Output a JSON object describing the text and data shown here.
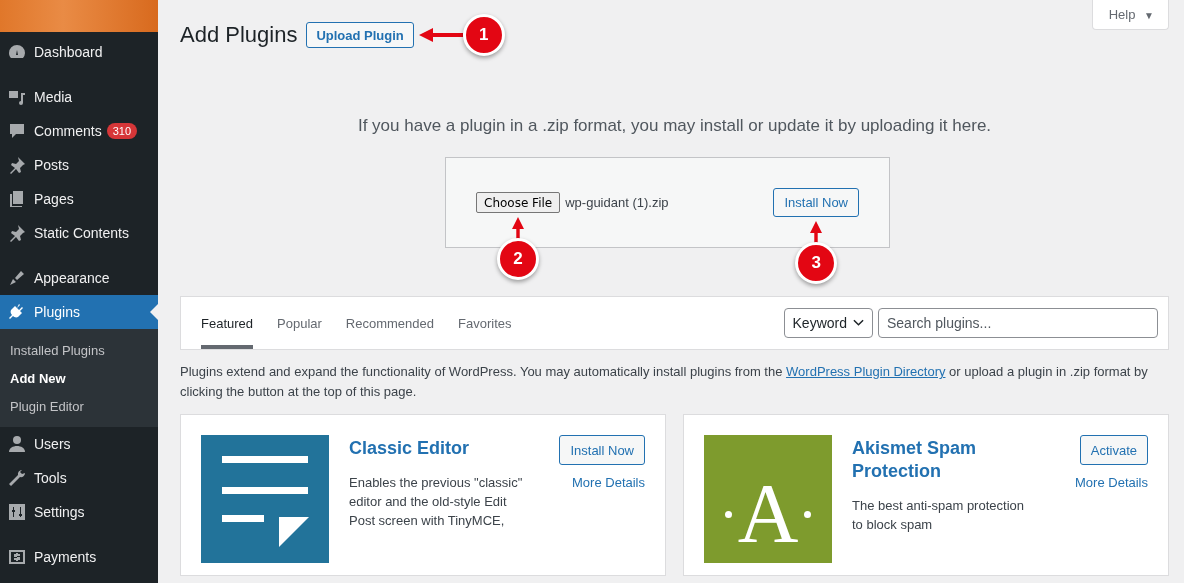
{
  "sidebar": {
    "groups": [
      {
        "items": [
          {
            "label": "Dashboard",
            "selected": false
          }
        ]
      },
      {
        "items": [
          {
            "label": "Media",
            "selected": false
          },
          {
            "label": "Comments",
            "selected": false,
            "badge": "310"
          },
          {
            "label": "Posts",
            "selected": false
          },
          {
            "label": "Pages",
            "selected": false
          },
          {
            "label": "Static Contents",
            "selected": false
          }
        ]
      },
      {
        "items": [
          {
            "label": "Appearance",
            "selected": false
          },
          {
            "label": "Plugins",
            "selected": true,
            "children": [
              {
                "label": "Installed Plugins",
                "selected": false
              },
              {
                "label": "Add New",
                "selected": true
              },
              {
                "label": "Plugin Editor",
                "selected": false
              }
            ]
          },
          {
            "label": "Users",
            "selected": false
          },
          {
            "label": "Tools",
            "selected": false
          },
          {
            "label": "Settings",
            "selected": false
          }
        ]
      },
      {
        "items": [
          {
            "label": "Payments",
            "selected": false
          }
        ]
      }
    ]
  },
  "help": {
    "label": "Help",
    "caret": "▼"
  },
  "header": {
    "title": "Add Plugins",
    "button": "Upload Plugin",
    "step": "1"
  },
  "upload": {
    "intro": "If you have a plugin in a .zip format, you may install or update it by uploading it here.",
    "choose_button": "Choose File",
    "file_name": "wp-guidant (1).zip",
    "install_button": "Install Now",
    "choose_step": "2",
    "install_step": "3"
  },
  "tabs": [
    {
      "label": "Featured",
      "selected": true
    },
    {
      "label": "Popular",
      "selected": false
    },
    {
      "label": "Recommended",
      "selected": false
    },
    {
      "label": "Favorites",
      "selected": false
    }
  ],
  "search": {
    "type_select": "Keyword",
    "placeholder": "Search plugins..."
  },
  "description": {
    "before": "Plugins extend and expand the functionality of WordPress. You may automatically install plugins from the ",
    "link": "WordPress Plugin Directory",
    "after": " or upload a plugin in .zip format by clicking the button at the top of this page."
  },
  "plugins": [
    {
      "kind": "document",
      "name": "Classic Editor",
      "summary": "Enables the previous \"classic\" editor and the old-style Edit Post screen with TinyMCE,",
      "action": "Install Now",
      "details": "More Details"
    },
    {
      "kind": "letter",
      "logo_text": "A",
      "name": "Akismet Spam Protection",
      "summary": "The best anti-spam protection to block spam",
      "action": "Activate",
      "details": "More Details"
    }
  ]
}
